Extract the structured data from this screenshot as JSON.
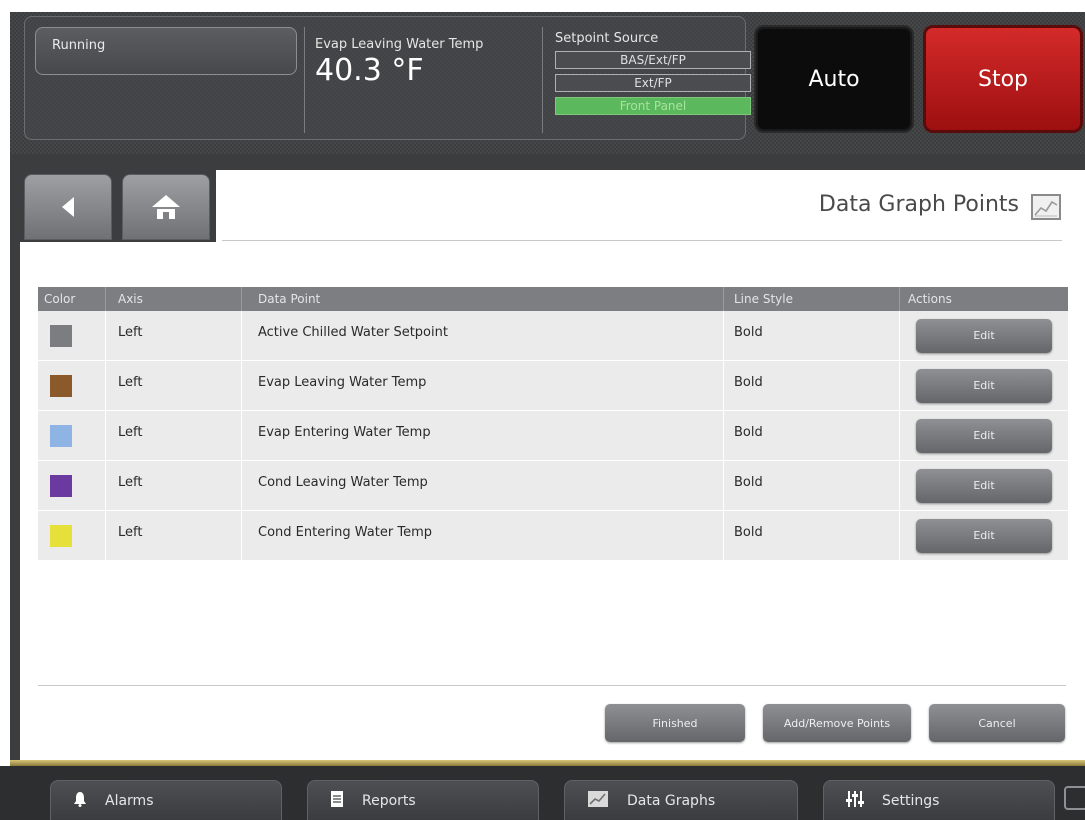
{
  "status": {
    "state": "Running",
    "evap_label": "Evap Leaving Water Temp",
    "evap_value": "40.3 °F",
    "setpoint_title": "Setpoint Source",
    "setpoint_options": [
      "BAS/Ext/FP",
      "Ext/FP",
      "Front Panel"
    ],
    "setpoint_active": "Front Panel"
  },
  "controls": {
    "auto_label": "Auto",
    "stop_label": "Stop"
  },
  "page": {
    "title": "Data Graph Points"
  },
  "table": {
    "headers": [
      "Color",
      "Axis",
      "Data Point",
      "Line Style",
      "Actions"
    ],
    "rows": [
      {
        "color": "#7b7d80",
        "axis": "Left",
        "point": "Active Chilled Water Setpoint",
        "style": "Bold",
        "action": "Edit"
      },
      {
        "color": "#8b5a2b",
        "axis": "Left",
        "point": "Evap Leaving Water Temp",
        "style": "Bold",
        "action": "Edit"
      },
      {
        "color": "#8eb4e3",
        "axis": "Left",
        "point": "Evap Entering Water Temp",
        "style": "Bold",
        "action": "Edit"
      },
      {
        "color": "#6a3aa0",
        "axis": "Left",
        "point": "Cond Leaving Water Temp",
        "style": "Bold",
        "action": "Edit"
      },
      {
        "color": "#e6e03a",
        "axis": "Left",
        "point": "Cond Entering Water Temp",
        "style": "Bold",
        "action": "Edit"
      }
    ]
  },
  "footer": {
    "finished": "Finished",
    "add_remove": "Add/Remove Points",
    "cancel": "Cancel"
  },
  "nav": {
    "alarms": "Alarms",
    "reports": "Reports",
    "data_graphs": "Data Graphs",
    "settings": "Settings"
  },
  "icons": {
    "back": "back-arrow-icon",
    "home": "home-icon",
    "title": "line-chart-icon",
    "alarms": "bell-icon",
    "reports": "document-icon",
    "data_graphs": "line-chart-icon",
    "settings": "sliders-icon",
    "chat": "chat-icon"
  }
}
